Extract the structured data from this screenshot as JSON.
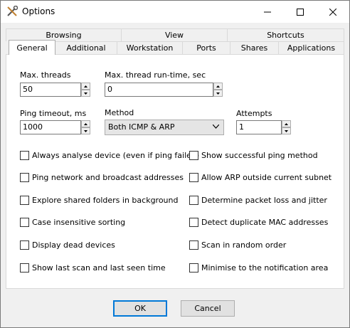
{
  "window": {
    "title": "Options"
  },
  "tabs_back": [
    {
      "label": "Browsing"
    },
    {
      "label": "View"
    },
    {
      "label": "Shortcuts"
    }
  ],
  "tabs_front": [
    {
      "label": "General",
      "active": true
    },
    {
      "label": "Additional"
    },
    {
      "label": "Workstation"
    },
    {
      "label": "Ports"
    },
    {
      "label": "Shares"
    },
    {
      "label": "Applications"
    }
  ],
  "fields": {
    "max_threads": {
      "label": "Max. threads",
      "value": "50"
    },
    "max_runtime": {
      "label": "Max. thread run-time, sec",
      "value": "0"
    },
    "ping_timeout": {
      "label": "Ping timeout, ms",
      "value": "1000"
    },
    "method": {
      "label": "Method",
      "value": "Both ICMP & ARP"
    },
    "attempts": {
      "label": "Attempts",
      "value": "1"
    }
  },
  "checkboxes_left": [
    {
      "label": "Always analyse device (even if ping failed)",
      "checked": false
    },
    {
      "label": "Ping network and broadcast addresses",
      "checked": false
    },
    {
      "label": "Explore shared folders in background",
      "checked": false
    },
    {
      "label": "Case insensitive sorting",
      "checked": false
    },
    {
      "label": "Display dead devices",
      "checked": false
    },
    {
      "label": "Show last scan and last seen time",
      "checked": false
    }
  ],
  "checkboxes_right": [
    {
      "label": "Show successful ping method",
      "checked": false
    },
    {
      "label": "Allow ARP outside current subnet",
      "checked": false
    },
    {
      "label": "Determine packet loss and jitter",
      "checked": false
    },
    {
      "label": "Detect duplicate MAC addresses",
      "checked": false
    },
    {
      "label": "Scan in random order",
      "checked": false
    },
    {
      "label": "Minimise to the notification area",
      "checked": false
    }
  ],
  "buttons": {
    "ok": "OK",
    "cancel": "Cancel"
  }
}
